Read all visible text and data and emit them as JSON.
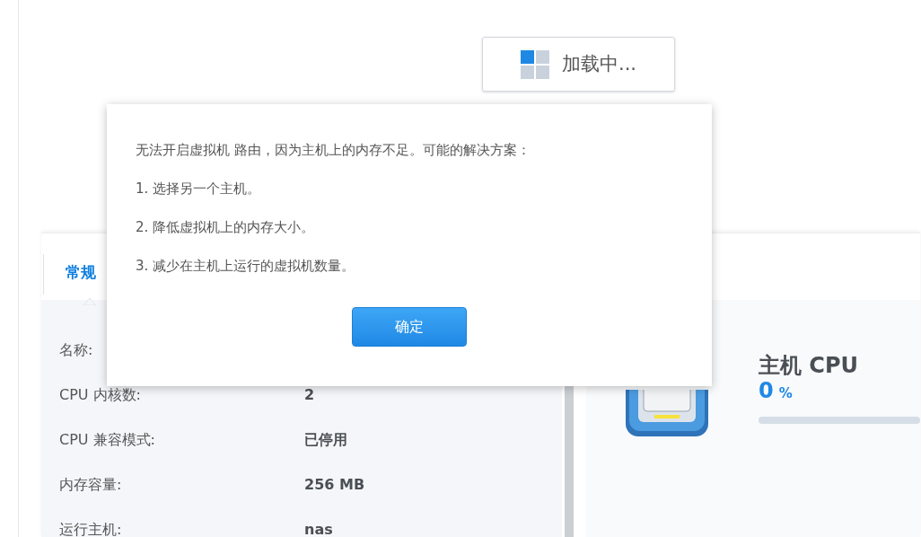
{
  "loading": {
    "text": "加载中..."
  },
  "tabs": [
    {
      "label": "常规",
      "selected": true
    }
  ],
  "details": [
    {
      "label": "名称:"
    },
    {
      "label": "CPU 内核数:",
      "value": "2"
    },
    {
      "label": "CPU 兼容模式:",
      "value": "已停用"
    },
    {
      "label": "内存容量:",
      "value": "256 MB"
    },
    {
      "label": "运行主机:",
      "value": "nas"
    }
  ],
  "host_cpu": {
    "title": "主机 CPU",
    "value": "0",
    "unit": "%",
    "level": 0
  },
  "dialog": {
    "lines": [
      "无法开启虚拟机 路由，因为主机上的内存不足。可能的解决方案：",
      "1. 选择另一个主机。",
      "2. 降低虚拟机上的内存大小。",
      "3. 减少在主机上运行的虚拟机数量。"
    ],
    "ok_button": "确定"
  }
}
